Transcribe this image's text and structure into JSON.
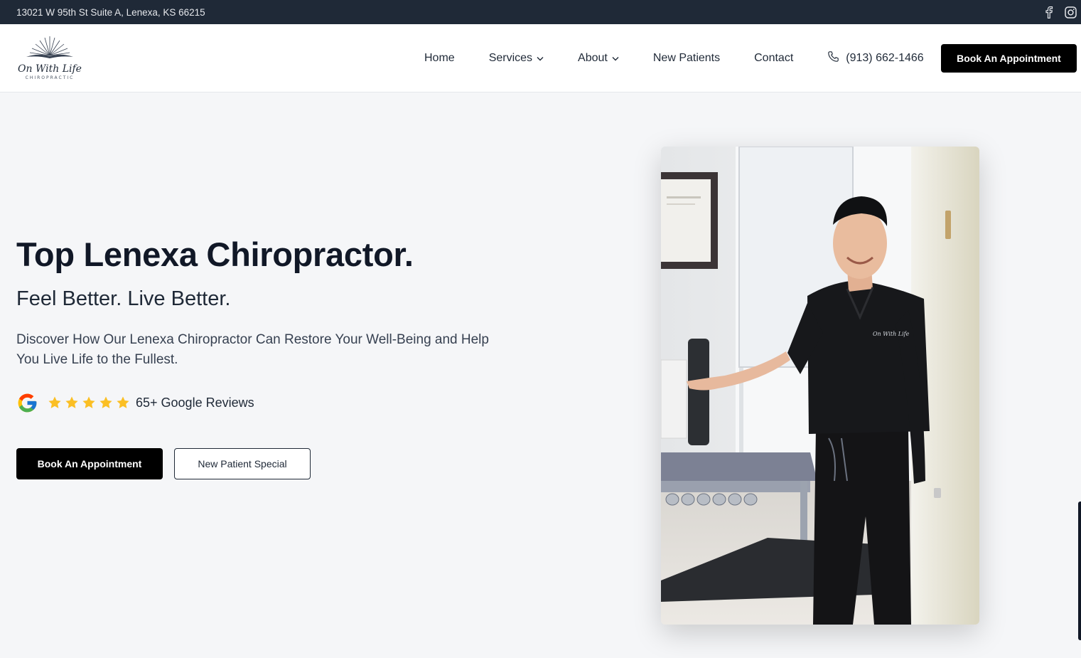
{
  "topbar": {
    "address": "13021 W 95th St Suite A, Lenexa, KS 66215",
    "social_icons": [
      "facebook-icon",
      "instagram-icon"
    ]
  },
  "logo": {
    "script_text": "On With Life",
    "sub_text": "CHIROPRACTIC"
  },
  "nav": {
    "items": [
      {
        "label": "Home",
        "has_dropdown": false
      },
      {
        "label": "Services",
        "has_dropdown": true
      },
      {
        "label": "About",
        "has_dropdown": true
      },
      {
        "label": "New Patients",
        "has_dropdown": false
      },
      {
        "label": "Contact",
        "has_dropdown": false
      }
    ],
    "phone": "(913) 662-1466",
    "cta": "Book An Appointment"
  },
  "hero": {
    "title": "Top Lenexa Chiropractor.",
    "subtitle": "Feel Better. Live Better.",
    "description": "Discover How Our Lenexa Chiropractor Can Restore Your Well-Being and Help You Live Life to the Fullest.",
    "rating": 5,
    "reviews_label": "65+ Google Reviews",
    "primary_button": "Book An Appointment",
    "secondary_button": "New Patient Special"
  },
  "colors": {
    "topbar_bg": "#1f2937",
    "page_bg": "#f5f6f8",
    "star": "#fbbf24",
    "button_dark": "#000000"
  }
}
